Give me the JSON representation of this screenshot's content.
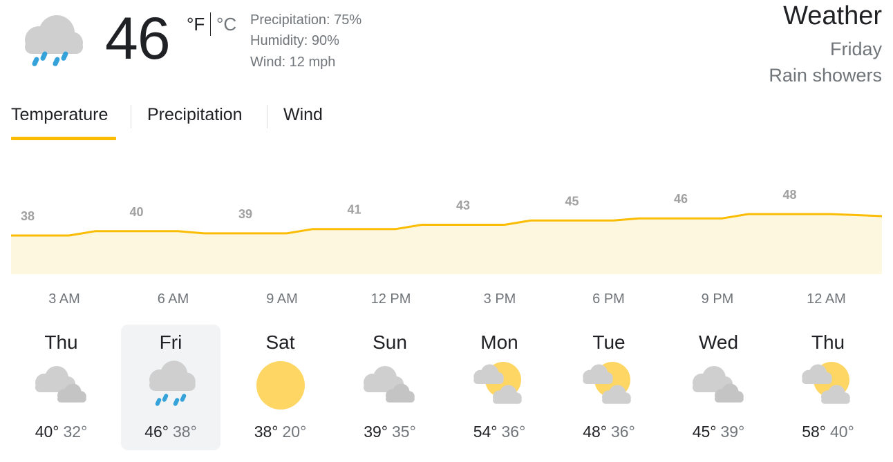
{
  "current": {
    "temp": "46",
    "unit_f": "°F",
    "unit_c": "°C",
    "icon": "rain-cloud-icon",
    "precipitation": "Precipitation: 75%",
    "humidity": "Humidity: 90%",
    "wind": "Wind: 12 mph"
  },
  "header": {
    "title": "Weather",
    "day": "Friday",
    "condition": "Rain showers"
  },
  "tabs": [
    {
      "label": "Temperature",
      "active": true
    },
    {
      "label": "Precipitation",
      "active": false
    },
    {
      "label": "Wind",
      "active": false
    }
  ],
  "colors": {
    "accent": "#fbbc04",
    "fill": "#fef7e0",
    "muted": "#70757a",
    "text": "#202124"
  },
  "chart_data": {
    "type": "area",
    "x": [
      "3 AM",
      "6 AM",
      "9 AM",
      "12 PM",
      "3 PM",
      "6 PM",
      "9 PM",
      "12 AM"
    ],
    "values": [
      38,
      40,
      39,
      41,
      43,
      45,
      46,
      48
    ],
    "value_labels": [
      "38",
      "40",
      "39",
      "41",
      "43",
      "45",
      "46",
      "48"
    ]
  },
  "days": [
    {
      "name": "Thu",
      "hi": "40°",
      "lo": "32°",
      "icon": "cloudy-icon",
      "selected": false
    },
    {
      "name": "Fri",
      "hi": "46°",
      "lo": "38°",
      "icon": "rain-cloud-icon",
      "selected": true
    },
    {
      "name": "Sat",
      "hi": "38°",
      "lo": "20°",
      "icon": "sun-icon",
      "selected": false
    },
    {
      "name": "Sun",
      "hi": "39°",
      "lo": "35°",
      "icon": "cloudy-icon",
      "selected": false
    },
    {
      "name": "Mon",
      "hi": "54°",
      "lo": "36°",
      "icon": "partly-cloudy-icon",
      "selected": false
    },
    {
      "name": "Tue",
      "hi": "48°",
      "lo": "36°",
      "icon": "partly-cloudy-icon",
      "selected": false
    },
    {
      "name": "Wed",
      "hi": "45°",
      "lo": "39°",
      "icon": "cloudy-icon",
      "selected": false
    },
    {
      "name": "Thu",
      "hi": "58°",
      "lo": "40°",
      "icon": "partly-cloudy-icon",
      "selected": false
    }
  ]
}
